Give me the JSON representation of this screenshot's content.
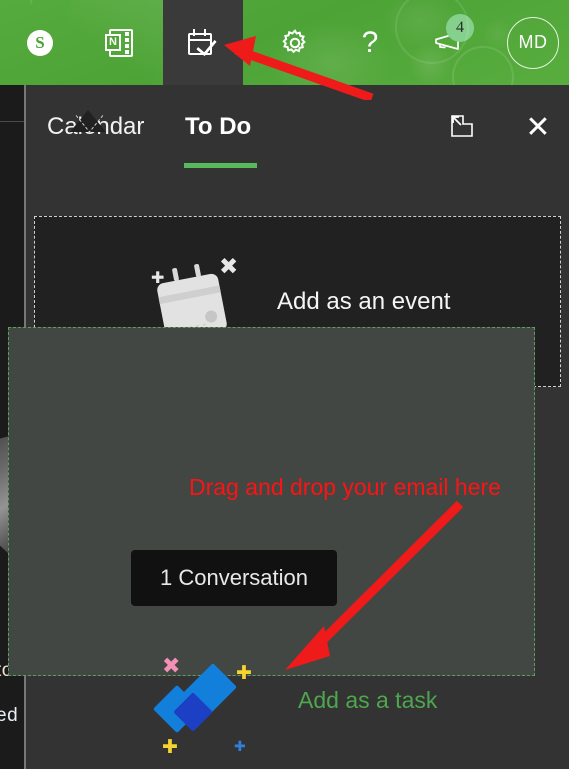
{
  "app": {
    "accent_green": "#4da336",
    "panel_bg": "#333333",
    "event_bg": "#212121",
    "task_bg": "#424743",
    "red": "#fc1414",
    "green_text": "#4ea64e"
  },
  "topbar": {
    "items": [
      {
        "name": "skype-icon",
        "label": "S",
        "title": "Skype"
      },
      {
        "name": "onenote-icon",
        "label": "N",
        "title": "OneNote"
      },
      {
        "name": "todo-icon",
        "label": "",
        "title": "To Do",
        "active": true
      },
      {
        "name": "gear-icon",
        "label": "",
        "title": "Settings"
      },
      {
        "name": "help-icon",
        "label": "?",
        "title": "Help"
      },
      {
        "name": "megaphone-icon",
        "label": "",
        "title": "What's new",
        "badge": "4"
      },
      {
        "name": "avatar",
        "label": "MD",
        "title": "Account"
      }
    ],
    "badge_count": "4",
    "avatar_initials": "MD",
    "help_glyph": "?",
    "skype_glyph": "S",
    "onenote_glyph": "N"
  },
  "panel": {
    "tabs": [
      {
        "label": "Calendar",
        "active": false
      },
      {
        "label": "To Do",
        "active": true
      }
    ],
    "popout_title": "Open in new window",
    "close_glyph": "✕",
    "close_title": "Close"
  },
  "event_card": {
    "title": "Add as an event",
    "icon_name": "calendar-illustration"
  },
  "task_card": {
    "drag_hint": "Drag and drop your email here",
    "conversation_chip": "1 Conversation",
    "title": "Add as a task",
    "icon_name": "todo-checkmark-logo"
  },
  "background": {
    "left_text_1": "to",
    "left_text_2": "ed"
  }
}
